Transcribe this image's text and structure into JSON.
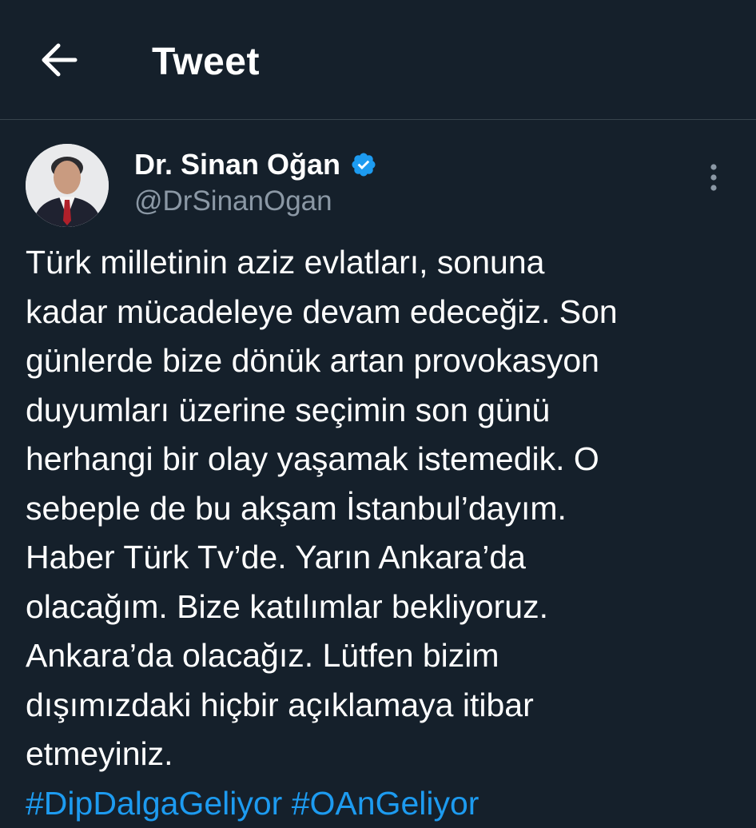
{
  "header": {
    "title": "Tweet",
    "back_icon": "arrow-left-icon"
  },
  "author": {
    "display_name": "Dr. Sinan Oğan",
    "handle": "@DrSinanOgan",
    "verified_icon": "verified-badge-icon",
    "avatar": "avatar"
  },
  "more_icon": "more-vertical-icon",
  "tweet": {
    "lines": [
      "Türk milletinin aziz evlatları, sonuna",
      "kadar mücadeleye devam edeceğiz. Son",
      "günlerde bize dönük artan provokasyon",
      "duyumları üzerine seçimin son günü",
      "herhangi bir olay yaşamak istemedik. O",
      "sebeple de bu akşam İstanbul’dayım.",
      "Haber Türk Tv’de. Yarın Ankara’da",
      "olacağım. Bize katılımlar bekliyoruz.",
      "Ankara’da olacağız. Lütfen bizim",
      "dışımızdaki hiçbir açıklamaya itibar",
      "etmeyiniz."
    ],
    "hashtags": [
      "#DipDalgaGeliyor",
      "#OAnGeliyor"
    ]
  },
  "colors": {
    "background": "#15202b",
    "text": "#ffffff",
    "secondary_text": "#8b98a5",
    "accent": "#1d9bf0",
    "divider": "#38444d"
  }
}
